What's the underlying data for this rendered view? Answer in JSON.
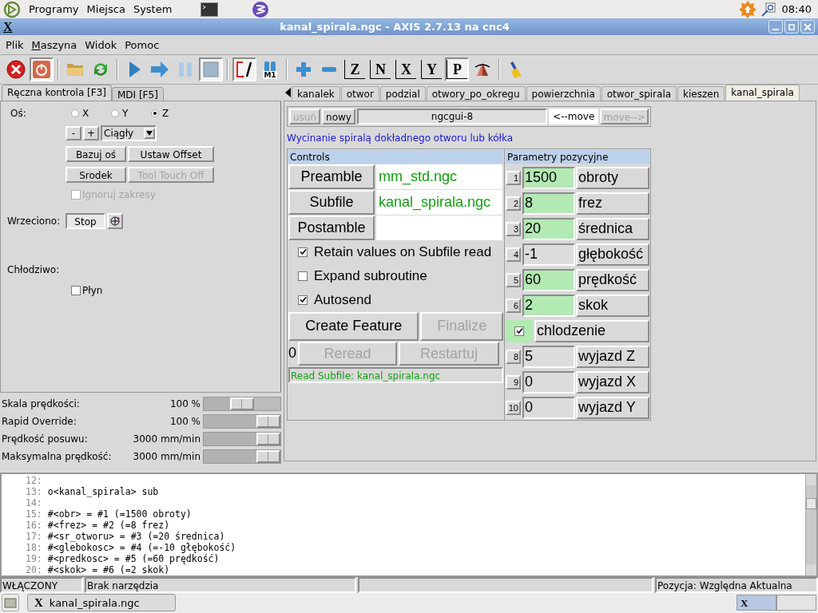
{
  "top_panel": {
    "menus": [
      "Programy",
      "Miejsca",
      "System"
    ],
    "clock": "08:40"
  },
  "window": {
    "logo": "X",
    "title": "kanal_spirala.ngc - AXIS 2.7.13 na cnc4"
  },
  "menu_bar": [
    {
      "label": "Plik",
      "underline_first": false
    },
    {
      "label": "Maszyna",
      "underline_first": true
    },
    {
      "label": "Widok",
      "underline_first": false
    },
    {
      "label": "Pomoc",
      "underline_first": false
    }
  ],
  "toolbar_groups": [
    [
      {
        "kind": "estop",
        "pressed": false
      },
      {
        "kind": "power",
        "pressed": true
      }
    ],
    [
      {
        "kind": "open",
        "pressed": false
      },
      {
        "kind": "reload",
        "pressed": false
      }
    ],
    [
      {
        "kind": "run",
        "pressed": false
      },
      {
        "kind": "step",
        "pressed": false
      },
      {
        "kind": "pause",
        "pressed": false
      },
      {
        "kind": "stop",
        "pressed": true
      }
    ],
    [
      {
        "kind": "block_delete",
        "pressed": true
      },
      {
        "kind": "optional_stop",
        "label": "M1",
        "pressed": false
      }
    ],
    [
      {
        "kind": "zoom_in",
        "pressed": false
      },
      {
        "kind": "zoom_out",
        "pressed": false
      },
      {
        "kind": "view",
        "label": "Z",
        "pressed": false
      },
      {
        "kind": "view",
        "label": "N",
        "pressed": false
      },
      {
        "kind": "view",
        "label": "X",
        "pressed": false
      },
      {
        "kind": "view",
        "label": "Y",
        "pressed": false
      },
      {
        "kind": "view",
        "label": "P",
        "pressed": true
      },
      {
        "kind": "rotate",
        "pressed": false
      }
    ],
    [
      {
        "kind": "clear",
        "pressed": false
      }
    ]
  ],
  "left_tabs": [
    {
      "label": "Ręczna kontrola [F3]",
      "selected": true
    },
    {
      "label": "MDI [F5]",
      "selected": false
    }
  ],
  "manual": {
    "axis_label": "Oś:",
    "axes": [
      {
        "label": "X",
        "selected": false
      },
      {
        "label": "Y",
        "selected": false
      },
      {
        "label": "Z",
        "selected": true
      }
    ],
    "jog_minus": "-",
    "jog_plus": "+",
    "jog_mode": "Ciągły",
    "buttons": [
      {
        "label": "Bazuj oś",
        "disabled": false
      },
      {
        "label": "Ustaw Offset",
        "disabled": false
      },
      {
        "label": "Srodek",
        "disabled": false
      },
      {
        "label": "Tool Touch Off",
        "disabled": true
      }
    ],
    "ignore_limits": {
      "label": "Ignoruj zakresy",
      "checked": false,
      "disabled": true
    },
    "spindle_label": "Wrzeciono:",
    "spindle_button": "Stop",
    "coolant_label": "Chłodziwo:",
    "flood": {
      "label": "Płyn",
      "checked": false
    }
  },
  "overrides": [
    {
      "label": "Skala prędkości:",
      "value": "100 %",
      "level": 0.5
    },
    {
      "label": "Rapid Override:",
      "value": "100 %",
      "level": 1
    },
    {
      "label": "Prędkość posuwu:",
      "value": "3000 mm/min",
      "level": 1
    },
    {
      "label": "Maksymalna prędkość:",
      "value": "3000 mm/min",
      "level": 1
    }
  ],
  "ngcgui_tabs": [
    {
      "label": "kanalek",
      "selected": false
    },
    {
      "label": "otwor",
      "selected": false
    },
    {
      "label": "podzial",
      "selected": false
    },
    {
      "label": "otwory_po_okregu",
      "selected": false
    },
    {
      "label": "powierzchnia",
      "selected": false
    },
    {
      "label": "otwor_spirala",
      "selected": false
    },
    {
      "label": "kieszen",
      "selected": false
    },
    {
      "label": "kanal_spirala",
      "selected": true
    }
  ],
  "ngcgui": {
    "delete": {
      "label": "usuń",
      "disabled": true
    },
    "new": {
      "label": "nowy",
      "disabled": false
    },
    "name": "ngcgui-8",
    "move_left": {
      "label": "<--move",
      "disabled": false
    },
    "move_right": {
      "label": "move-->",
      "disabled": true
    },
    "description": "Wycinanie spiralą dokładnego otworu lub kółka"
  },
  "controls": {
    "title": "Controls",
    "files": [
      {
        "label": "Preamble",
        "value": "mm_std.ngc"
      },
      {
        "label": "Subfile",
        "value": "kanal_spirala.ngc"
      },
      {
        "label": "Postamble"
      }
    ],
    "options": [
      {
        "label": "Retain values on Subfile read",
        "checked": true
      },
      {
        "label": "Expand subroutine",
        "checked": false
      },
      {
        "label": "Autosend",
        "checked": true
      }
    ],
    "create": {
      "label": "Create Feature",
      "disabled": false
    },
    "finalize": {
      "label": "Finalize",
      "disabled": true
    },
    "count": "0",
    "reread": {
      "label": "Reread",
      "disabled": true
    },
    "restart": {
      "label": "Restartuj",
      "disabled": true
    },
    "status": "Read Subfile: kanal_spirala.ngc"
  },
  "positional": {
    "title": "Parametry pozycyjne",
    "params": [
      {
        "kind": "entry",
        "index": "1",
        "value": "1500",
        "label": "obroty",
        "highlighted": true
      },
      {
        "kind": "entry",
        "index": "2",
        "value": "8",
        "label": "frez",
        "highlighted": true
      },
      {
        "kind": "entry",
        "index": "3",
        "value": "20",
        "label": "średnica",
        "highlighted": true
      },
      {
        "kind": "entry",
        "index": "4",
        "value": "-1",
        "label": "głębokość",
        "highlighted": false
      },
      {
        "kind": "entry",
        "index": "5",
        "value": "60",
        "label": "prędkość",
        "highlighted": true
      },
      {
        "kind": "entry",
        "index": "6",
        "value": "2",
        "label": "skok",
        "highlighted": true
      },
      {
        "kind": "check",
        "caption": "chlodzenie",
        "checked": true,
        "highlighted": true
      },
      {
        "kind": "entry",
        "index": "8",
        "value": "5",
        "label": "wyjazd Z",
        "highlighted": false
      },
      {
        "kind": "entry",
        "index": "9",
        "value": "0",
        "label": "wyjazd X",
        "highlighted": false
      },
      {
        "kind": "entry",
        "index": "10",
        "value": "0",
        "label": "wyjazd Y",
        "highlighted": false
      }
    ]
  },
  "code": [
    {
      "number": "12:"
    },
    {
      "number": "13:",
      "text": "o<kanal_spirala> sub"
    },
    {
      "number": "14:"
    },
    {
      "number": "15:",
      "text": "#<obr> = #1 (=1500 obroty)"
    },
    {
      "number": "16:",
      "text": "#<frez> = #2 (=8 frez)"
    },
    {
      "number": "17:",
      "text": "#<sr_otworu> = #3 (=20 średnica)"
    },
    {
      "number": "18:",
      "text": "#<glebokosc> = #4 (=-10 głębokość)"
    },
    {
      "number": "19:",
      "text": "#<predkosc> = #5 (=60 prędkość)"
    },
    {
      "number": "20:",
      "text": "#<skok> = #6 (=2 skok)"
    }
  ],
  "status_bar": {
    "state": "WŁĄCZONY",
    "tool": "Brak narzędzia",
    "position": "Pozycja: Względna Aktualna"
  },
  "taskbar": {
    "tasks": [
      {
        "icon_label": "X",
        "label": "kanal_spirala.ngc",
        "selected": false
      }
    ],
    "workspaces": [
      {
        "icon_label": "X",
        "selected": true
      },
      {
        "selected": false
      }
    ]
  }
}
